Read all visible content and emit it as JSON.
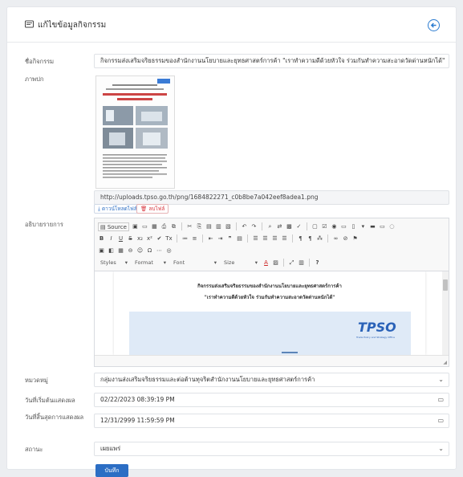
{
  "header": {
    "title": "แก้ไขข้อมูลกิจกรรม"
  },
  "form": {
    "activity_name": {
      "label": "ชื่อกิจกรรม",
      "value": "กิจกรรมส่งเสริมจริยธรรมของสำนักงานนโยบายและยุทธศาสตร์การค้า \"เราทำความดีด้วยหัวใจ ร่วมกันทำความสะอาดวัดด่านหนักได้\""
    },
    "image": {
      "label": "ภาพปก",
      "url": "http://uploads.tpso.go.th/png/1684822271_c0b8be7a042eef8adea1.png",
      "download_label": "ดาวน์โหลดไฟล์",
      "delete_label": "ลบไฟล์",
      "thumb_caption": "\"เราทำความดีด้วยหัวใจ ร่วมกันทำความสะอาดวัดด่านหนักได้\""
    },
    "description": {
      "label": "อธิบายรายการ",
      "toolbar": {
        "source_label": "Source",
        "styles_label": "Styles",
        "format_label": "Format",
        "font_label": "Font",
        "size_label": "Size",
        "help_label": "?"
      },
      "content_line1": "กิจกรรมส่งเสริมจริยธรรมของสำนักงานนโยบายและยุทธศาสตร์การค้า",
      "content_line2": "\"เราทำความดีด้วยหัวใจ ร่วมกันทำความสะอาดวัดด่านหนักได้\"",
      "logo_text": "TPSO",
      "logo_subtext": "Trade Policy and Strategy Office"
    },
    "category": {
      "label": "หมวดหมู่",
      "value": "กลุ่มงานส่งเสริมจริยธรรมและต่อต้านทุจริตสำนักงานนโยบายและยุทธศาสตร์การค้า"
    },
    "start_date": {
      "label": "วันที่เริ่มต้นแสดงผล",
      "value": "02/22/2023 08:39:19 PM"
    },
    "end_date": {
      "label": "วันที่สิ้นสุดการแสดงผล",
      "value": "12/31/2999 11:59:59 PM"
    },
    "status": {
      "label": "สถานะ",
      "value": "เผยแพร่"
    },
    "save_label": "บันทึก"
  },
  "colors": {
    "primary": "#2c6ec4",
    "danger": "#d9363e",
    "accent": "#2a7bd0"
  }
}
